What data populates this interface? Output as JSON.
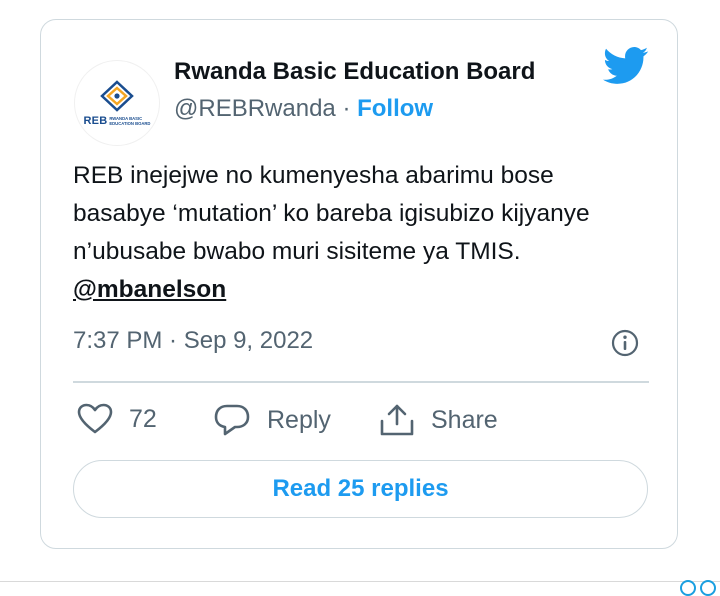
{
  "tweet": {
    "author_name": "Rwanda Basic Education Board",
    "handle": "@REBRwanda",
    "separator": "·",
    "follow_label": "Follow",
    "avatar_logo_text": "REB",
    "avatar_logo_subtext_1": "RWANDA BASIC",
    "avatar_logo_subtext_2": "EDUCATION BOARD",
    "text": "REB inejejwe no kumenyesha abarimu bose basabye ‘mutation’ ko  bareba igisubizo kijyanye n’ubusabe bwabo muri sisiteme ya TMIS.",
    "mention": "@mbanelson",
    "timestamp": "7:37 PM · Sep 9, 2022",
    "like_count": "72",
    "reply_label": "Reply",
    "share_label": "Share",
    "read_replies_label": "Read 25 replies"
  },
  "colors": {
    "accent": "#1d9bf0",
    "text": "#0f1419",
    "muted": "#536471",
    "border": "#cfd9de"
  },
  "icons": [
    "twitter-bird-icon",
    "info-icon",
    "heart-icon",
    "reply-bubble-icon",
    "share-icon"
  ]
}
